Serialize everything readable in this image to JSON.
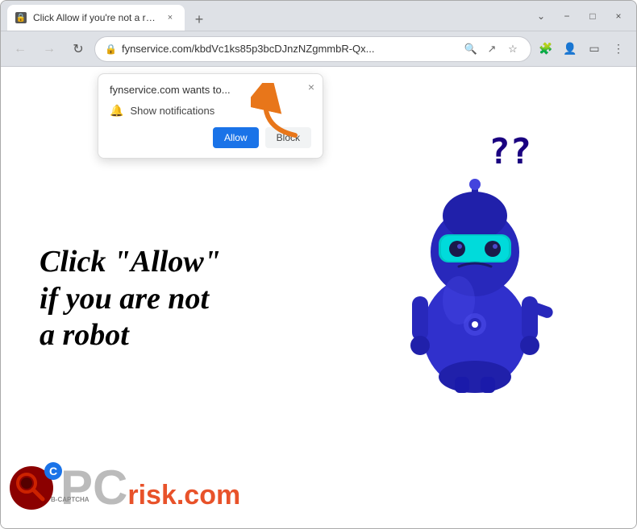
{
  "window": {
    "title": "Click Allow if you're not a robot",
    "tab_title": "Click Allow if you're not a robot",
    "url": "fynservice.com/kbdVc1ks85p3bcDJnzNZgmmbR-Qx...",
    "favicon": "🔒"
  },
  "window_controls": {
    "minimize": "−",
    "maximize": "□",
    "close": "×",
    "chevron_down": "⌄"
  },
  "nav": {
    "back": "←",
    "forward": "→",
    "reload": "↻"
  },
  "popup": {
    "site_text": "fynservice.com wants to...",
    "notification_label": "Show notifications",
    "allow_label": "Allow",
    "block_label": "Block",
    "close_label": "×"
  },
  "main": {
    "headline_line1": "Click \"Allow\"",
    "headline_line2": "if you are not",
    "headline_line3": "a robot"
  },
  "question_marks": "??",
  "pcrisk": {
    "pc_label": "PC",
    "risk_label": "risk.com"
  },
  "bcaptcha": {
    "label": "B-CAPTCHA"
  }
}
